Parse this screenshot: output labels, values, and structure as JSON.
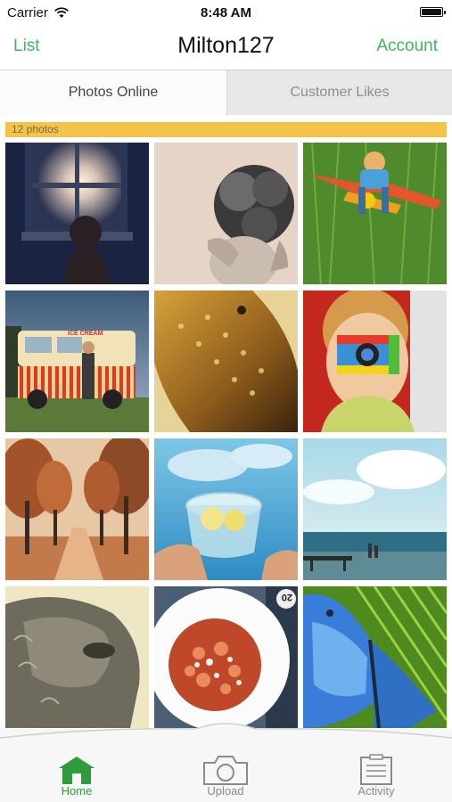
{
  "status_bar": {
    "carrier": "Carrier",
    "time": "8:48 AM",
    "battery_level": 1.0
  },
  "nav": {
    "left": "List",
    "title": "Milton127",
    "right": "Account"
  },
  "tabs": [
    {
      "label": "Photos Online",
      "selected": true
    },
    {
      "label": "Customer Likes",
      "selected": false
    }
  ],
  "photo_count": "12 photos",
  "photos": [
    {
      "name": "child-at-window"
    },
    {
      "name": "child-covering-eyes"
    },
    {
      "name": "toddler-on-toy-airplane"
    },
    {
      "name": "ice-cream-van"
    },
    {
      "name": "bearded-dragon"
    },
    {
      "name": "child-with-toy-camera"
    },
    {
      "name": "autumn-tree-avenue"
    },
    {
      "name": "glass-of-lemon-water"
    },
    {
      "name": "beach-pier"
    },
    {
      "name": "sheep-portrait"
    },
    {
      "name": "pasta-dish"
    },
    {
      "name": "blue-butterfly"
    }
  ],
  "plate_tag": "20",
  "van_sign": "ICE CREAM",
  "tabbar": {
    "home": "Home",
    "upload": "Upload",
    "activity": "Activity"
  },
  "colors": {
    "accent": "#3bb85b",
    "count_bar": "#f3c34a",
    "tab_inactive_bg": "#e7e7e7"
  },
  "icons": [
    "wifi-icon",
    "battery-icon",
    "home-icon",
    "camera-icon",
    "activity-icon"
  ]
}
